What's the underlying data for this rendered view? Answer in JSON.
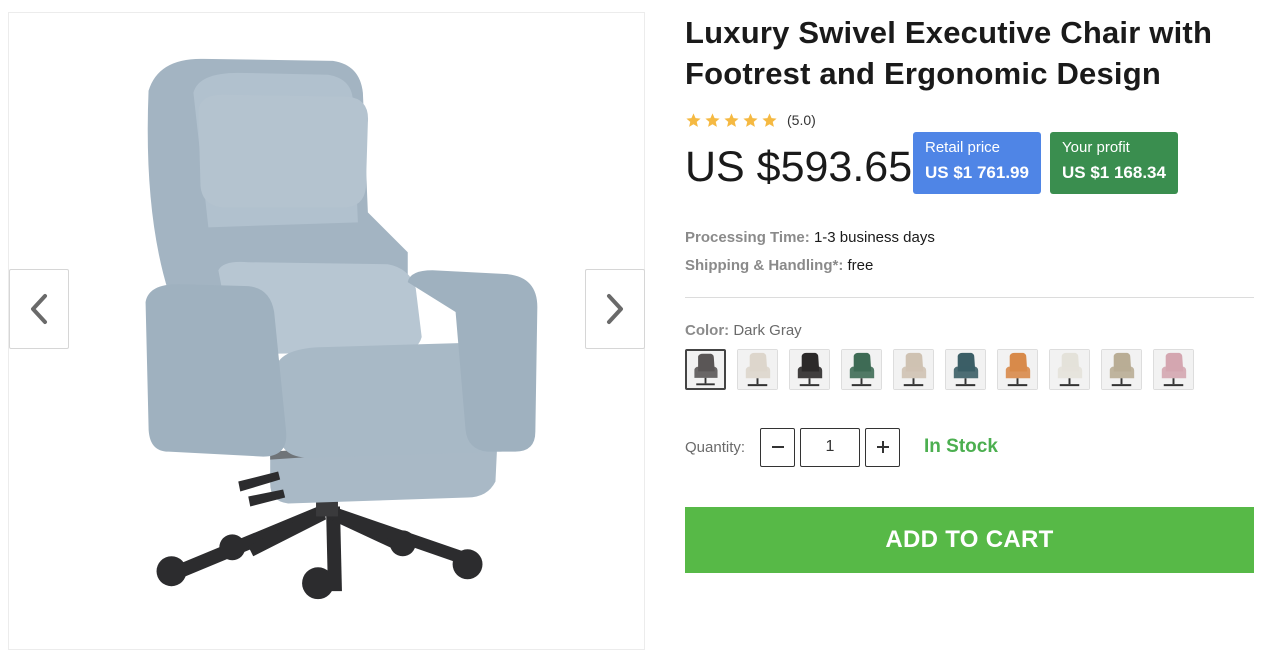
{
  "product": {
    "title": "Luxury Swivel Executive Chair with Footrest and Ergonomic Design",
    "rating_text": "(5.0)",
    "rating_stars": 5,
    "star_color": "#f5b942",
    "price": "US $593.65"
  },
  "badges": {
    "retail_label": "Retail price",
    "retail_value": "US $1 761.99",
    "retail_color": "#4f85e6",
    "profit_label": "Your profit",
    "profit_value": "US $1 168.34",
    "profit_color": "#3a8e4f"
  },
  "meta": {
    "processing_label": "Processing Time:",
    "processing_value": "1-3 business days",
    "shipping_label": "Shipping & Handling*:",
    "shipping_value": "free"
  },
  "color": {
    "label": "Color:",
    "selected": "Dark Gray",
    "swatches": [
      {
        "name": "dark-gray",
        "color": "#5a5656",
        "selected": true
      },
      {
        "name": "cream",
        "color": "#ddd6cc"
      },
      {
        "name": "black",
        "color": "#2c2a2a"
      },
      {
        "name": "green",
        "color": "#3e6b55"
      },
      {
        "name": "beige",
        "color": "#cfc2b2"
      },
      {
        "name": "teal",
        "color": "#3b5e66"
      },
      {
        "name": "orange",
        "color": "#d88a4a"
      },
      {
        "name": "off-white",
        "color": "#e4e2da"
      },
      {
        "name": "khaki",
        "color": "#b9ad95"
      },
      {
        "name": "pink",
        "color": "#d4a6b0"
      }
    ]
  },
  "quantity": {
    "label": "Quantity:",
    "value": "1",
    "minus_icon": "minus-icon",
    "plus_icon": "plus-icon"
  },
  "stock": {
    "text": "In Stock",
    "color": "#4caf50"
  },
  "cart": {
    "button_label": "ADD TO CART",
    "color": "#57b947"
  },
  "gallery": {
    "prev_icon": "chevron-left-icon",
    "next_icon": "chevron-right-icon"
  }
}
